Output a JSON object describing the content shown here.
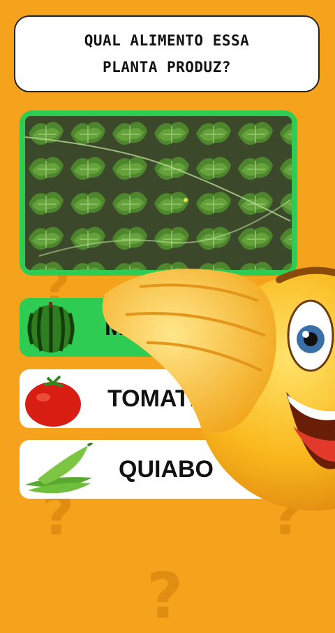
{
  "question": {
    "line1": "QUAL ALIMENTO ESSA",
    "line2": "PLANTA PRODUZ?"
  },
  "image": {
    "subject": "watermelon-plant-photo"
  },
  "options": [
    {
      "label": "MELANCIA",
      "icon": "watermelon-icon",
      "highlight_color": "#2ECC52"
    },
    {
      "label": "TOMATE",
      "icon": "tomato-icon"
    },
    {
      "label": "QUIABO",
      "icon": "okra-icon"
    }
  ],
  "decorations": {
    "question_mark": "?"
  },
  "colors": {
    "background": "#F5A21C",
    "correct": "#2ECC52",
    "card": "#FFFFFF"
  }
}
